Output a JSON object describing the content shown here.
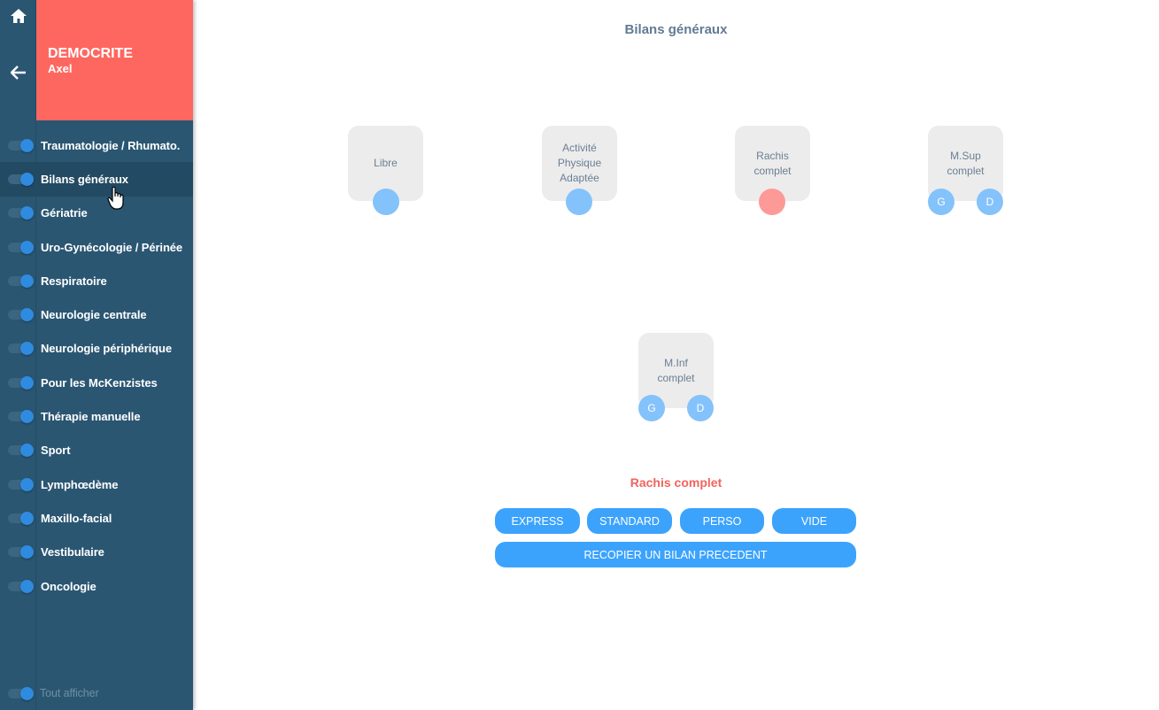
{
  "patient": {
    "last_name": "DEMOCRITE",
    "first_name": "Axel"
  },
  "rail": {
    "home_icon": "home-icon",
    "back_icon": "arrow-left-icon"
  },
  "menu": {
    "items": [
      {
        "label": "Traumatologie / Rhumato.",
        "enabled": true,
        "active": false
      },
      {
        "label": "Bilans généraux",
        "enabled": true,
        "active": true
      },
      {
        "label": "Gériatrie",
        "enabled": true,
        "active": false
      },
      {
        "label": "Uro-Gynécologie / Périnée",
        "enabled": true,
        "active": false
      },
      {
        "label": "Respiratoire",
        "enabled": true,
        "active": false
      },
      {
        "label": "Neurologie centrale",
        "enabled": true,
        "active": false
      },
      {
        "label": "Neurologie périphérique",
        "enabled": true,
        "active": false
      },
      {
        "label": "Pour les McKenzistes",
        "enabled": true,
        "active": false
      },
      {
        "label": "Thérapie manuelle",
        "enabled": true,
        "active": false
      },
      {
        "label": "Sport",
        "enabled": true,
        "active": false
      },
      {
        "label": "Lymphœdème",
        "enabled": true,
        "active": false
      },
      {
        "label": "Maxillo-facial",
        "enabled": true,
        "active": false
      },
      {
        "label": "Vestibulaire",
        "enabled": true,
        "active": false
      },
      {
        "label": "Oncologie",
        "enabled": true,
        "active": false
      }
    ],
    "show_all_label": "Tout afficher"
  },
  "main": {
    "title": "Bilans généraux",
    "cards": [
      {
        "label": "Libre",
        "dots": [
          ""
        ]
      },
      {
        "label": "Activité Physique Adaptée",
        "dots": [
          ""
        ]
      },
      {
        "label": "Rachis complet",
        "dots": [
          ""
        ],
        "selected": true
      },
      {
        "label": "M.Sup complet",
        "dots": [
          "G",
          "D"
        ]
      },
      {
        "label": "M.Inf complet",
        "dots": [
          "G",
          "D"
        ]
      }
    ],
    "selected_name": "Rachis complet",
    "buttons": {
      "express": "EXPRESS",
      "standard": "STANDARD",
      "perso": "PERSO",
      "vide": "VIDE",
      "copy_previous": "RECOPIER UN BILAN PRECEDENT"
    }
  },
  "colors": {
    "sidebar": "#2a5672",
    "patient_header": "#fe6760",
    "accent_blue": "#3ca3fc",
    "selected_red": "#f1645e"
  }
}
